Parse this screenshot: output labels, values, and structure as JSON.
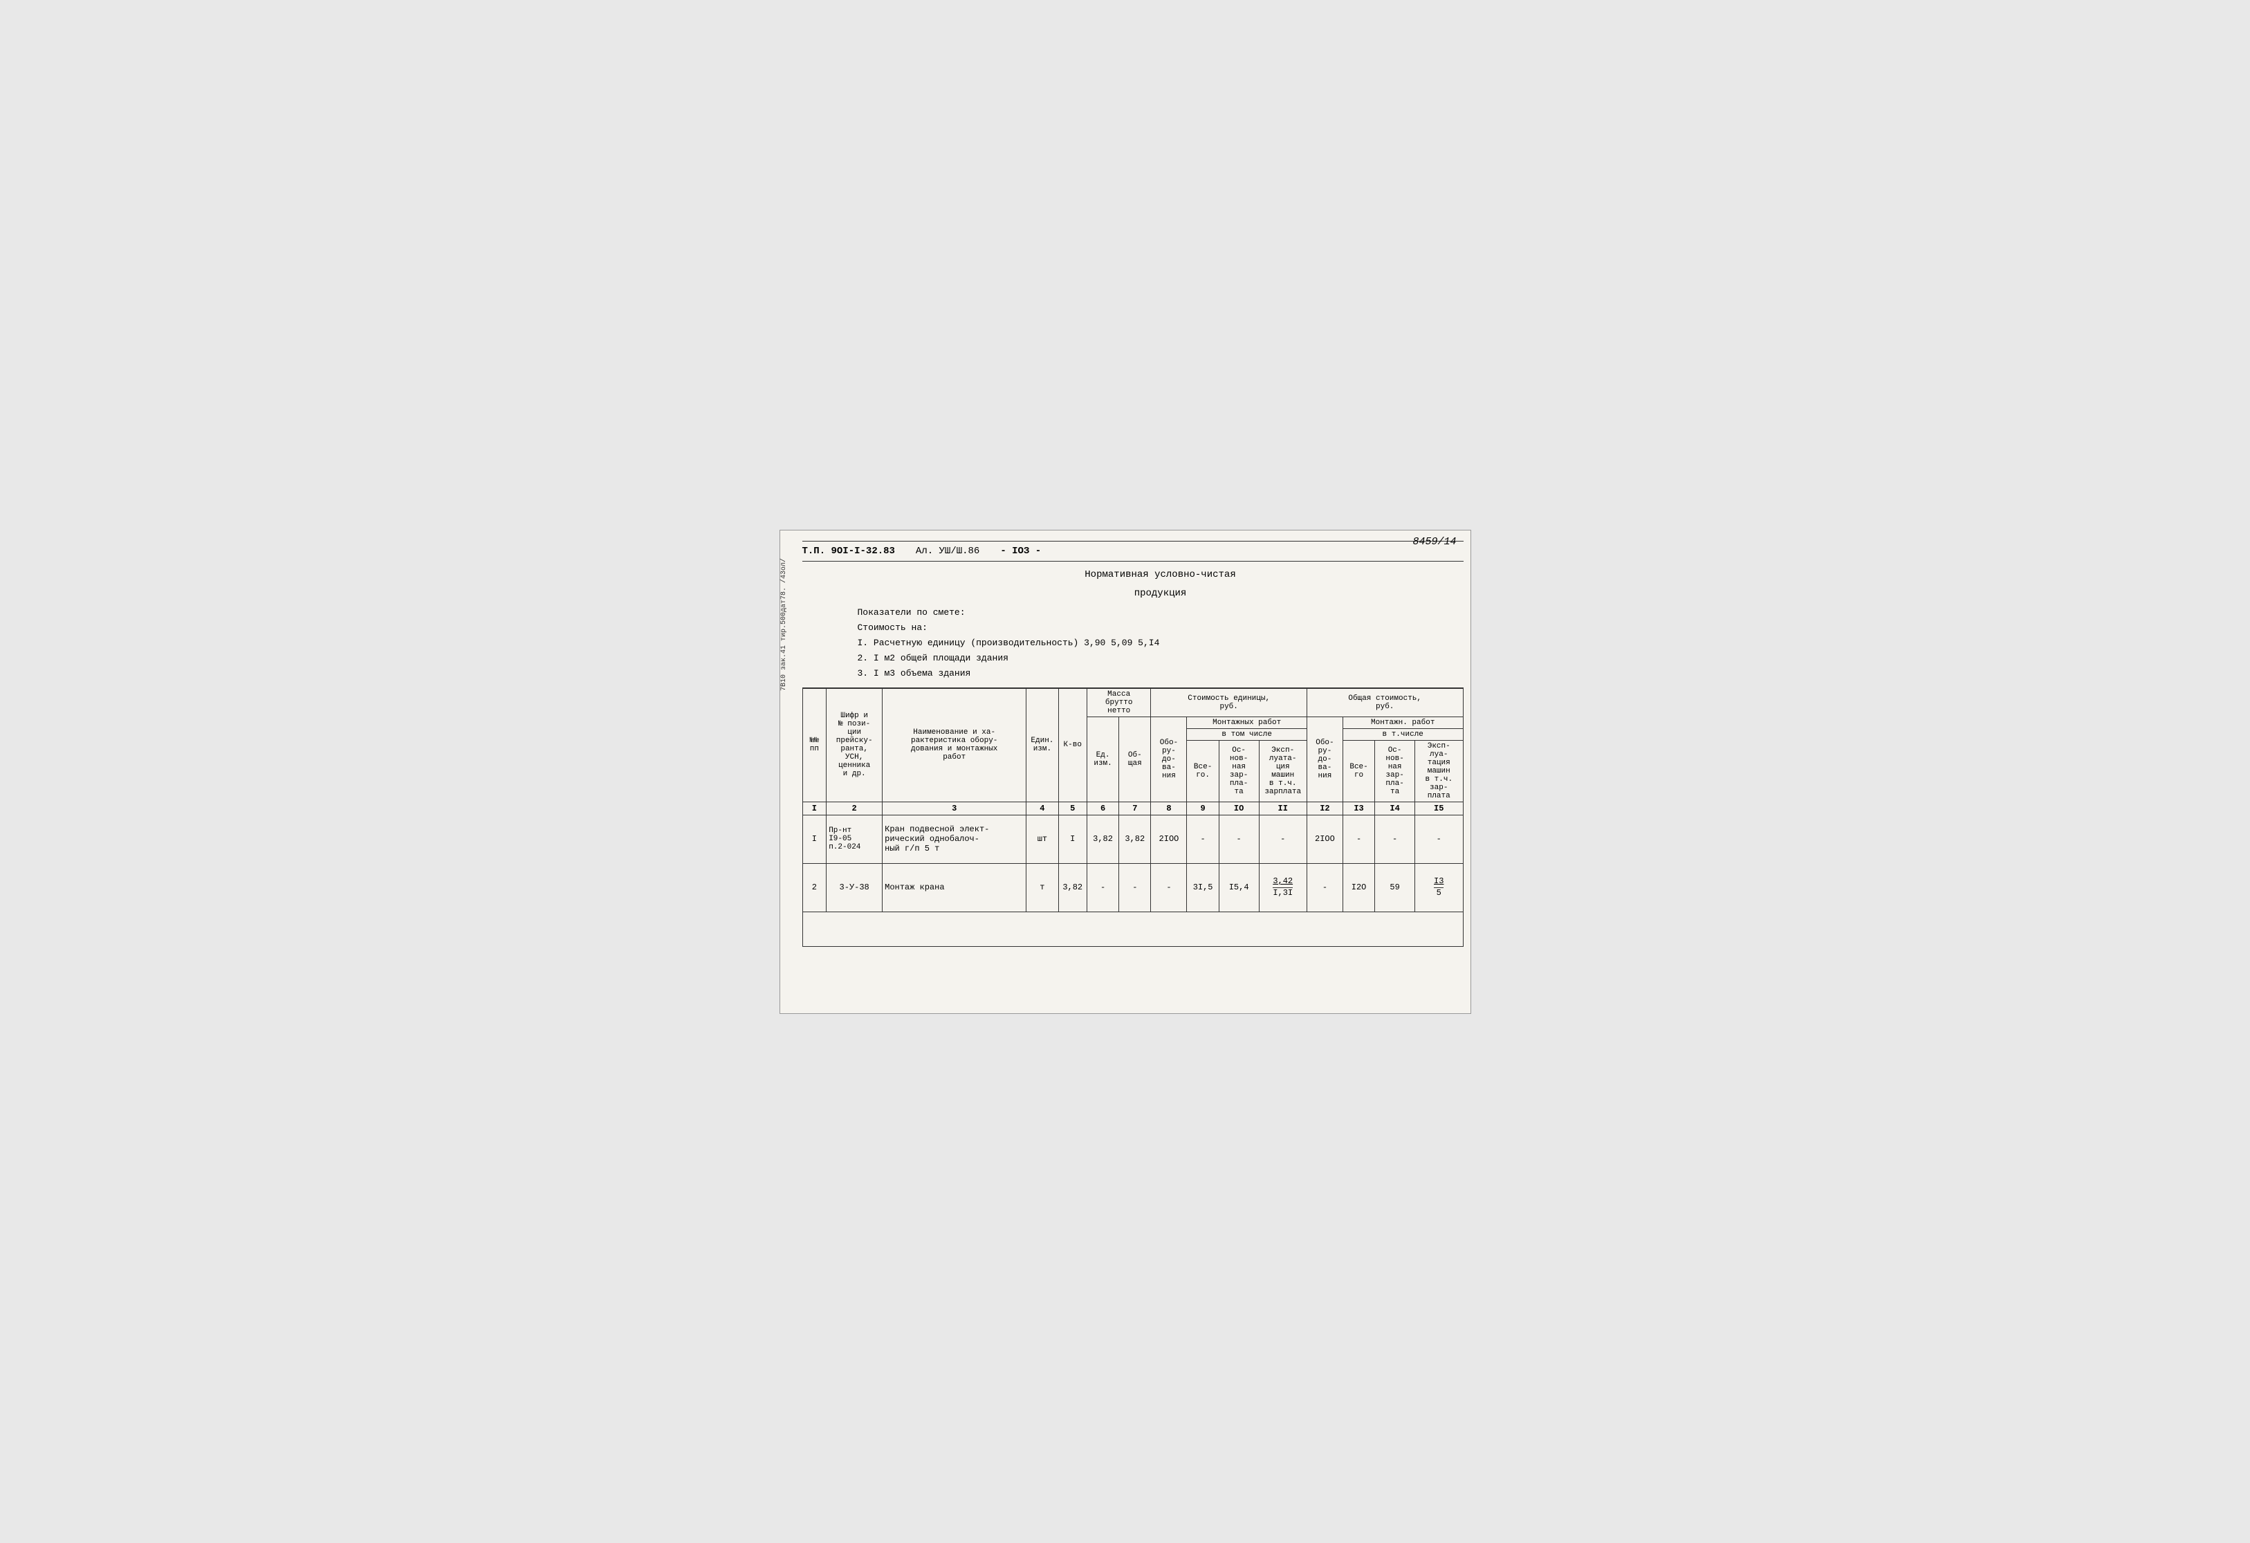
{
  "page": {
    "number": "8459/14",
    "left_label": "7В10 зак.41 тир.500дат78. /43ол/",
    "header": {
      "tp": "Т.П. 9ОI-I-32.83",
      "al": "Ал. УШ/Ш.86",
      "num": "- IОЗ -"
    },
    "info": {
      "title1": "Нормативная условно-чистая",
      "title2": "продукция",
      "indicators_label": "Показатели по смете:",
      "cost_label": "Стоимость на:",
      "item1": "I. Расчетную единицу (производительность)  3,90    5,09    5,I4",
      "item2": "2. I м2 общей площади здания",
      "item3": "3. I м3 объема здания"
    },
    "table": {
      "col_headers": [
        {
          "id": "col1",
          "lines": [
            "№№",
            "пп"
          ]
        },
        {
          "id": "col2",
          "lines": [
            "Шифр и",
            "№ пози-",
            "ции",
            "прейску-",
            "ранта,",
            "УСН,",
            "ценника",
            "и др."
          ]
        },
        {
          "id": "col3",
          "lines": [
            "Наименование и ха-",
            "рактеристика обору-",
            "дования и монтажных",
            "работ"
          ]
        },
        {
          "id": "col4",
          "lines": [
            "Един.",
            "изм."
          ]
        },
        {
          "id": "col5",
          "lines": [
            "К-во"
          ]
        },
        {
          "id": "col6_7",
          "label": "Масса брутто нетто",
          "sub": [
            {
              "id": "col6",
              "lines": [
                "Ед.",
                "изм."
              ]
            },
            {
              "id": "col7",
              "lines": [
                "Об-",
                "щая"
              ]
            }
          ]
        },
        {
          "id": "col8",
          "lines": [
            "Обо-",
            "ру-",
            "до-",
            "ва-",
            "ния"
          ]
        },
        {
          "id": "col9_11",
          "label": "Монтажных работ",
          "sublabel": "в том числе",
          "sub": [
            {
              "id": "col9",
              "lines": [
                "Все-",
                "го."
              ]
            },
            {
              "id": "col10",
              "lines": [
                "Ос-",
                "нов-",
                "ная",
                "зар-",
                "пла-",
                "та"
              ]
            },
            {
              "id": "col11",
              "lines": [
                "Эксп-",
                "луата-",
                "ция",
                "машин",
                "в т.ч.",
                "зарплата"
              ]
            }
          ]
        },
        {
          "id": "col12",
          "lines": [
            "Обо-",
            "ру-",
            "до-",
            "ва-",
            "ния"
          ]
        },
        {
          "id": "col13_15",
          "label": "Монтажн. работ",
          "sublabel": "в т.числе",
          "sub": [
            {
              "id": "col13",
              "lines": [
                "Все-",
                "го"
              ]
            },
            {
              "id": "col14",
              "lines": [
                "Ос-",
                "нов-",
                "ная",
                "зар-",
                "пла-",
                "та"
              ]
            },
            {
              "id": "col15",
              "lines": [
                "Эксп-",
                "луа-",
                "тация",
                "машин",
                "в т.ч.",
                "зар-",
                "плата"
              ]
            }
          ]
        }
      ],
      "group_headers": [
        {
          "span_col": "col6_7",
          "text": "Масса\nбрутто\nнетто"
        },
        {
          "span_col": "cost_unit",
          "text": "Стоимость единицы,\nруб."
        },
        {
          "span_col": "cost_total",
          "text": "Общая стоимость,\nруб."
        }
      ],
      "num_row": [
        "I",
        "2",
        "3",
        "4",
        "5",
        "6",
        "7",
        "8",
        "9",
        "IO",
        "II",
        "I2",
        "I3",
        "I4",
        "I5"
      ],
      "data_rows": [
        {
          "num": "I",
          "code": "Пр-нт\nI9-05\nп.2-024",
          "name": "Кран подвесной элект-\nрический однобалоч-\nный г/п 5 т",
          "unit": "шт",
          "qty": "I",
          "mass_unit": "3,82",
          "mass_total": "3,82",
          "cost_equip": "2IОО",
          "mont_all": "-",
          "mont_main": "-",
          "mont_expl": "-",
          "total_equip": "2IОО",
          "total_mont_all": "-",
          "total_mont_main": "-",
          "total_mont_expl": "-"
        },
        {
          "num": "2",
          "code": "3-У-38",
          "name": "Монтаж крана",
          "unit": "т",
          "qty": "3,82",
          "mass_unit": "-",
          "mass_total": "-",
          "cost_equip": "-",
          "mont_all": "3I,5",
          "mont_main": "I5,4",
          "mont_expl": "3,42\nI,3I",
          "total_equip": "-",
          "total_mont_all": "I2О",
          "total_mont_main": "59",
          "total_mont_expl": "I3\n5"
        }
      ]
    }
  }
}
